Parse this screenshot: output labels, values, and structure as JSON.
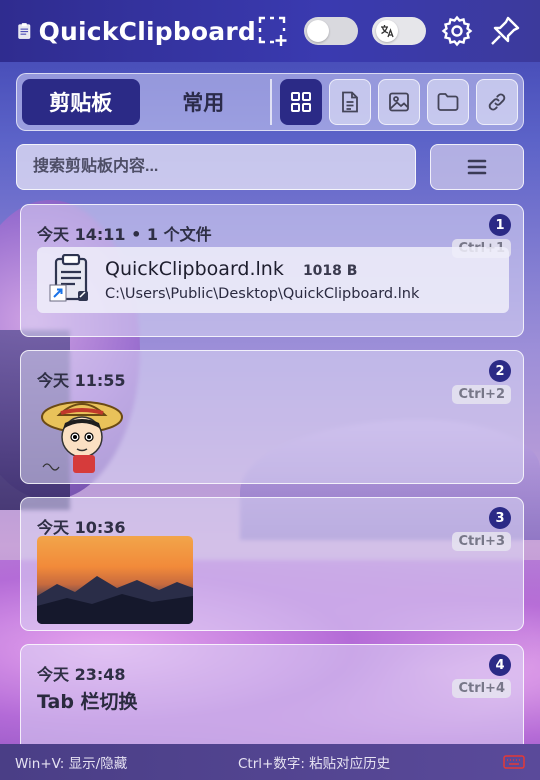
{
  "app": {
    "title": "QuickClipboard"
  },
  "tabs": [
    {
      "label": "剪贴板",
      "active": true
    },
    {
      "label": "常用",
      "active": false
    }
  ],
  "filters": [
    {
      "icon": "grid-icon",
      "active": true
    },
    {
      "icon": "document-icon",
      "active": false
    },
    {
      "icon": "image-icon",
      "active": false
    },
    {
      "icon": "folder-icon",
      "active": false
    },
    {
      "icon": "link-icon",
      "active": false
    }
  ],
  "search": {
    "placeholder": "搜索剪贴板内容..."
  },
  "items": [
    {
      "index": "1",
      "time": "今天 14:11 • 1 个文件",
      "shortcut": "Ctrl+1",
      "type": "file",
      "file_name": "QuickClipboard.lnk",
      "file_size": "1018 B",
      "file_path": "C:\\Users\\Public\\Desktop\\QuickClipboard.lnk"
    },
    {
      "index": "2",
      "time": "今天 11:55",
      "shortcut": "Ctrl+2",
      "type": "image"
    },
    {
      "index": "3",
      "time": "今天 10:36",
      "shortcut": "Ctrl+3",
      "type": "image"
    },
    {
      "index": "4",
      "time": "今天 23:48",
      "shortcut": "Ctrl+4",
      "type": "text",
      "text": "Tab 栏切换"
    }
  ],
  "footer": {
    "left": "Win+V: 显示/隐藏",
    "center": "Ctrl+数字: 粘贴对应历史"
  },
  "colors": {
    "accent": "#2b2a86",
    "header": "#3a3ab0",
    "keyboard_icon": "#e53935"
  }
}
